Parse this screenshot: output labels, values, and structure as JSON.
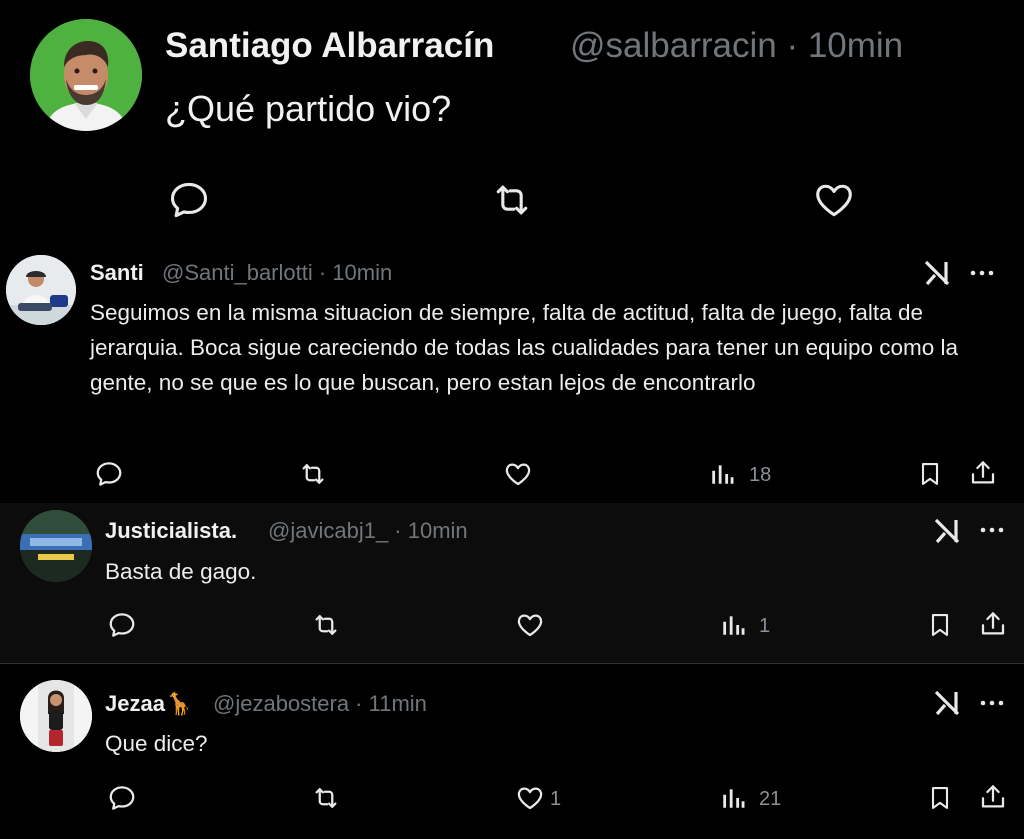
{
  "main_post": {
    "author_name": "Santiago Albarracín",
    "meta": "@salbarracin · 10min",
    "text": "¿Qué partido vio?",
    "avatar_icon": "man-portrait-avatar",
    "actions": [
      "reply-icon",
      "repost-icon",
      "like-icon"
    ]
  },
  "replies": [
    {
      "author_name": "Santi",
      "meta": "@Santi_barlotti · 10min",
      "text": "Seguimos en la misma situacion de siempre, falta de actitud, falta de juego, falta de jerarquia. Boca sigue careciendo de todas las cualidades para tener un equipo como la gente, no se que es lo que buscan, pero estan lejos de encontrarlo",
      "views": "18",
      "likes": ""
    },
    {
      "author_name": "Justicialista.",
      "meta": "@javicabj1_ · 10min",
      "text": "Basta de gago.",
      "views": "1",
      "likes": ""
    },
    {
      "author_name": "Jezaa🦒",
      "meta": "@jezabostera · 11min",
      "text": "Que dice?",
      "views": "21",
      "likes": "1"
    }
  ],
  "colors": {
    "background": "#000000",
    "text": "#e7e9ea",
    "muted": "#71767b",
    "avatar_green": "#4cae3c"
  }
}
